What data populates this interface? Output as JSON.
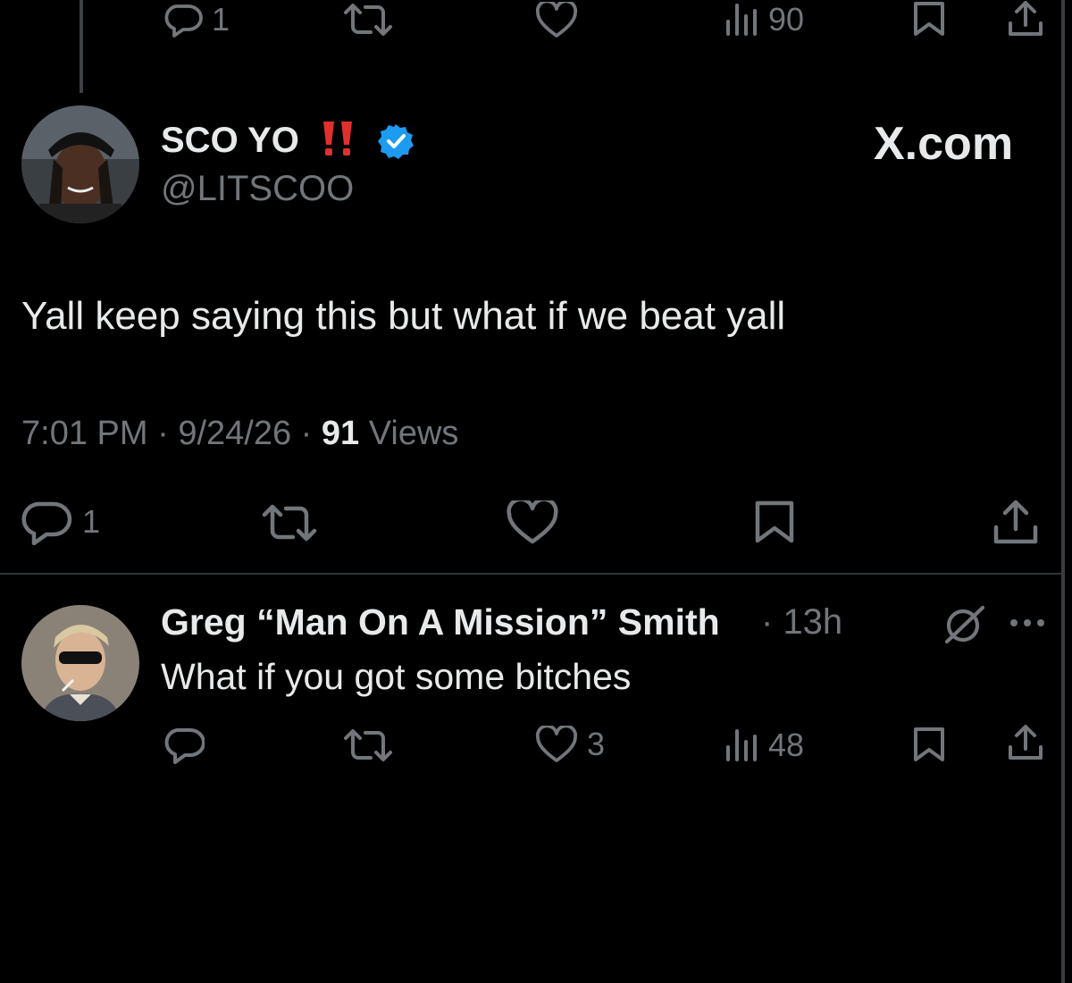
{
  "top_actions": {
    "reply_count": "1",
    "views_count": "90"
  },
  "tweet": {
    "display_name": "SCO YO",
    "emoji": "‼️",
    "handle": "@LITSCOO",
    "brand": "X.com",
    "text": "Yall keep saying this but what if we beat yall",
    "time": "7:01 PM",
    "date": "9/24/26",
    "views_number": "91",
    "views_label": "Views",
    "reply_count": "1"
  },
  "reply": {
    "display_name": "Greg “Man On A Mission” Smith",
    "time_ago": "13h",
    "text": "What if you got some bitches",
    "like_count": "3",
    "views_count": "48"
  },
  "icons": {
    "reply": "speech-bubble-icon",
    "retweet": "retweet-icon",
    "like": "heart-icon",
    "views": "bar-chart-icon",
    "bookmark": "bookmark-icon",
    "share": "share-icon",
    "verified": "verified-badge-icon",
    "grok": "grok-icon",
    "more": "more-icon"
  },
  "colors": {
    "background": "#000000",
    "text_primary": "#e7e9ea",
    "text_secondary": "#71767b",
    "verified": "#1d9bf0",
    "emoji_red": "#e0302d"
  }
}
